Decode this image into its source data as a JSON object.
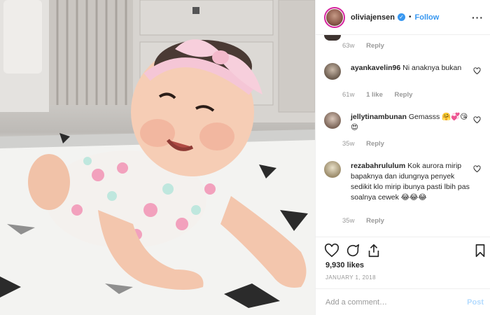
{
  "header": {
    "username": "oliviajensen",
    "separator": "•",
    "follow_label": "Follow",
    "more_label": "···"
  },
  "comments": [
    {
      "username": "",
      "text": "",
      "time": "63w",
      "reply_label": "Reply"
    },
    {
      "username": "ayankavelin96",
      "text": "Ni anaknya bukan",
      "time": "61w",
      "likes": "1 like",
      "reply_label": "Reply"
    },
    {
      "username": "jellytinambunan",
      "text": "Gemasss 🤗💞😘😍",
      "time": "35w",
      "reply_label": "Reply"
    },
    {
      "username": "rezabahrululum",
      "text": "Kok aurora mirip bapaknya dan idungnya penyek sedikit klo mirip ibunya pasti lbih pas soalnya cewek 😂😂😂",
      "time": "35w",
      "reply_label": "Reply"
    }
  ],
  "post": {
    "likes": "9,930 likes",
    "date": "JANUARY 1, 2018"
  },
  "add_comment": {
    "placeholder": "Add a comment…",
    "post_label": "Post"
  },
  "colors": {
    "accent": "#3897f0",
    "post_disabled": "#b3dbff",
    "muted": "#999999"
  },
  "icons": [
    "verified-badge-icon",
    "more-options-icon",
    "heart-icon",
    "comment-icon",
    "share-icon",
    "bookmark-icon"
  ]
}
